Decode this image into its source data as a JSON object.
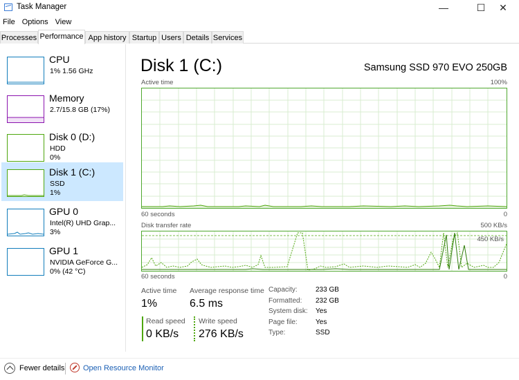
{
  "window": {
    "title": "Task Manager",
    "minimize": "—",
    "maximize": "☐",
    "close": "✕"
  },
  "menu": [
    "File",
    "Options",
    "View"
  ],
  "tabs": [
    "Processes",
    "Performance",
    "App history",
    "Startup",
    "Users",
    "Details",
    "Services"
  ],
  "active_tab": "Performance",
  "sidebar": [
    {
      "name": "CPU",
      "sub": [
        "1% 1.56 GHz"
      ],
      "color": "#117dbb"
    },
    {
      "name": "Memory",
      "sub": [
        "2.7/15.8 GB (17%)"
      ],
      "color": "#8b12ae"
    },
    {
      "name": "Disk 0 (D:)",
      "sub": [
        "HDD",
        "0%"
      ],
      "color": "#4da60c"
    },
    {
      "name": "Disk 1 (C:)",
      "sub": [
        "SSD",
        "1%"
      ],
      "color": "#4da60c",
      "selected": true
    },
    {
      "name": "GPU 0",
      "sub": [
        "Intel(R) UHD Grap...",
        "3%"
      ],
      "color": "#117dbb"
    },
    {
      "name": "GPU 1",
      "sub": [
        "NVIDIA GeForce G...",
        "0% (42 °C)"
      ],
      "color": "#117dbb"
    }
  ],
  "main": {
    "title": "Disk 1 (C:)",
    "model": "Samsung SSD 970 EVO 250GB",
    "active_time_graph": {
      "label": "Active time",
      "max_label": "100%",
      "x_label": "60 seconds",
      "min_label": "0"
    },
    "transfer_graph": {
      "label": "Disk transfer rate",
      "max_label": "500 KB/s",
      "line_label": "450 KB/s",
      "x_label": "60 seconds",
      "min_label": "0"
    },
    "stats": {
      "active_time_label": "Active time",
      "active_time_value": "1%",
      "response_label": "Average response time",
      "response_value": "6.5 ms",
      "read_label": "Read speed",
      "read_value": "0 KB/s",
      "write_label": "Write speed",
      "write_value": "276 KB/s"
    },
    "properties": [
      {
        "key": "Capacity:",
        "value": "233 GB"
      },
      {
        "key": "Formatted:",
        "value": "232 GB"
      },
      {
        "key": "System disk:",
        "value": "Yes"
      },
      {
        "key": "Page file:",
        "value": "Yes"
      },
      {
        "key": "Type:",
        "value": "SSD"
      }
    ]
  },
  "footer": {
    "fewer_details": "Fewer details",
    "resource_monitor": "Open Resource Monitor"
  },
  "colors": {
    "accent_green": "#4da60c",
    "selected_bg": "#cce8ff",
    "link": "#1a5fb4"
  }
}
